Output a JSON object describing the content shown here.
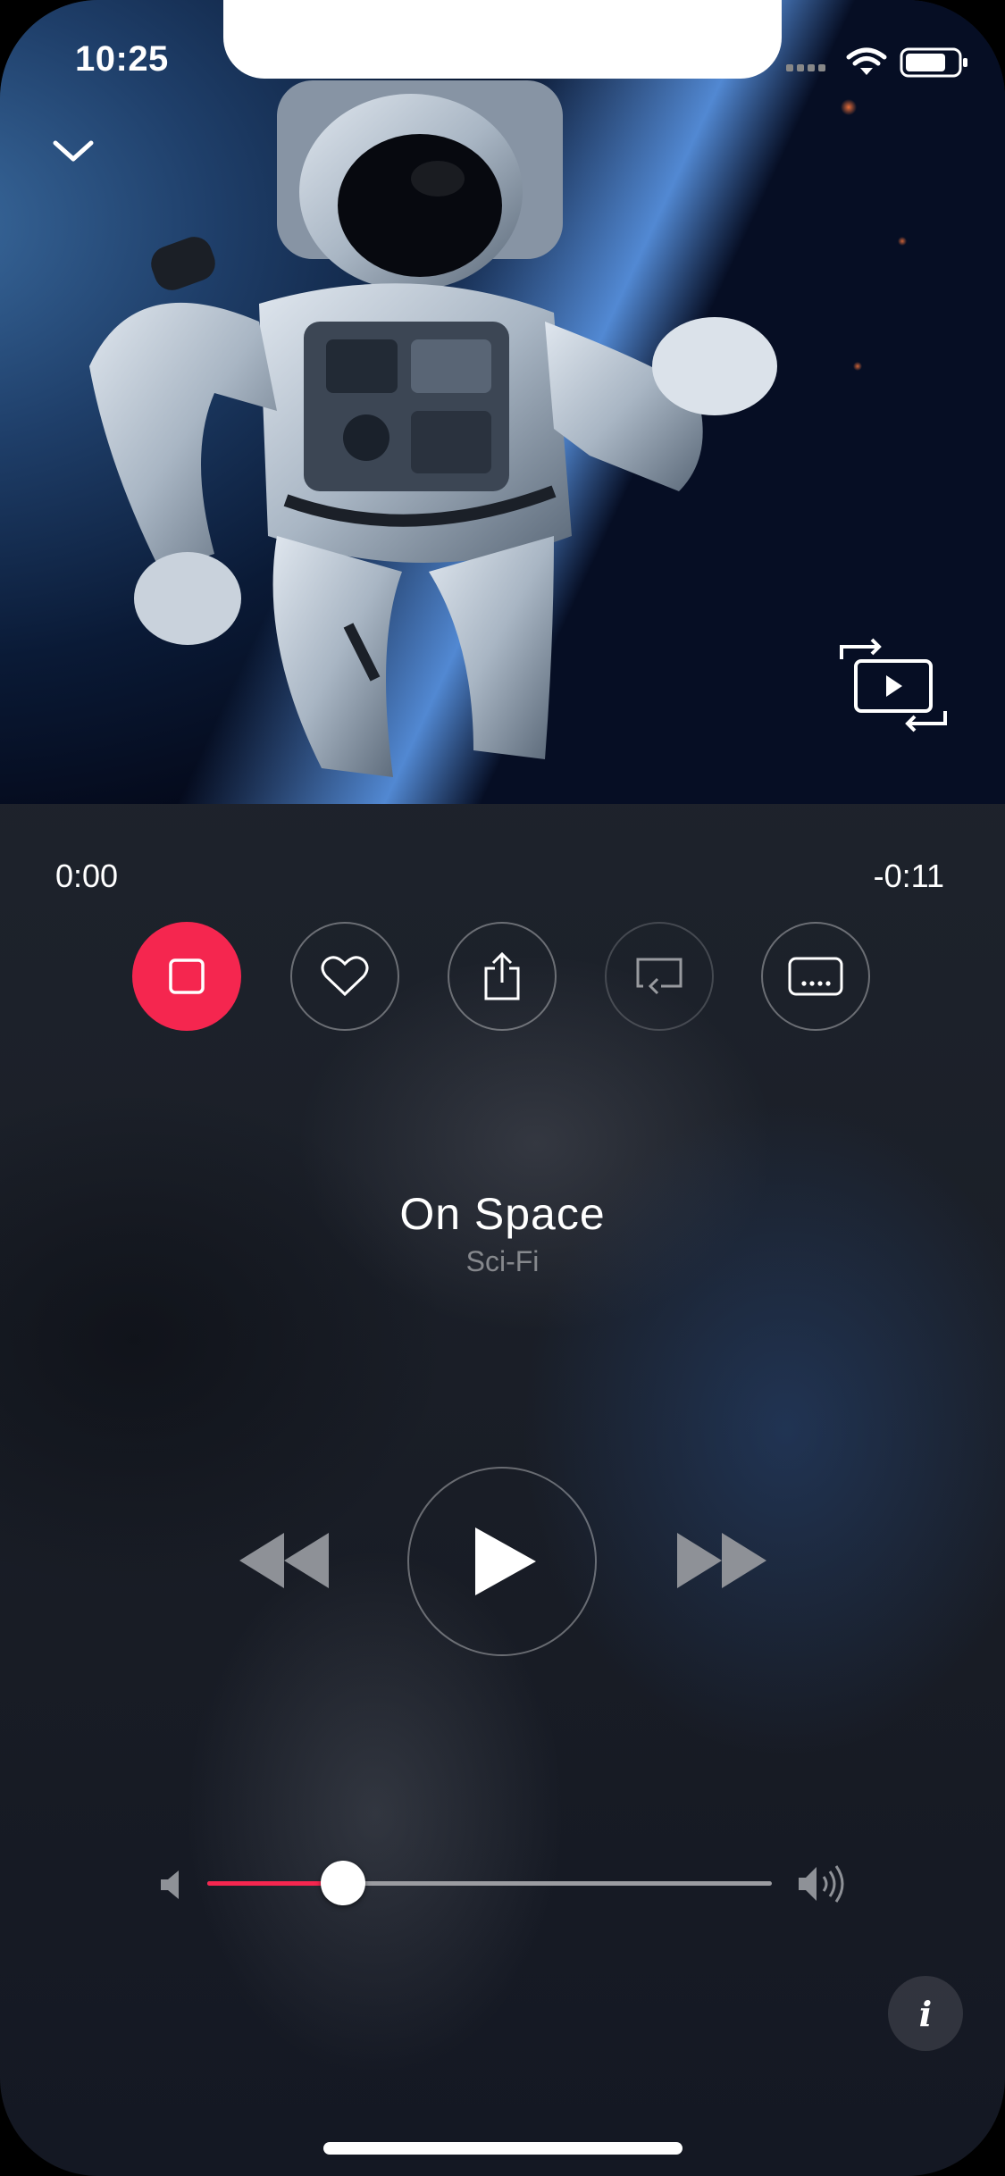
{
  "status_bar": {
    "time": "10:25",
    "icons": [
      "cellular-signal-icon",
      "wifi-icon",
      "battery-icon"
    ]
  },
  "video": {
    "artwork": "astronaut in space over earth",
    "collapse_icon": "chevron-down-icon",
    "pip_icon": "picture-in-picture-icon"
  },
  "playback": {
    "elapsed": "0:00",
    "remaining": "-0:11",
    "volume_fraction": 0.24
  },
  "actions": [
    {
      "name": "stop",
      "icon": "stop-icon"
    },
    {
      "name": "favorite",
      "icon": "heart-icon"
    },
    {
      "name": "share",
      "icon": "share-icon"
    },
    {
      "name": "reply",
      "icon": "reply-icon"
    },
    {
      "name": "subtitles",
      "icon": "subtitles-icon"
    }
  ],
  "track": {
    "title": "On Space",
    "category": "Sci-Fi"
  },
  "transport": {
    "icons": [
      "rewind-icon",
      "play-icon",
      "fast-forward-icon"
    ]
  },
  "info_button": {
    "label": "i"
  },
  "colors": {
    "accent": "#f5264f",
    "background": "#1d222b",
    "track": "#9b9ca1"
  }
}
